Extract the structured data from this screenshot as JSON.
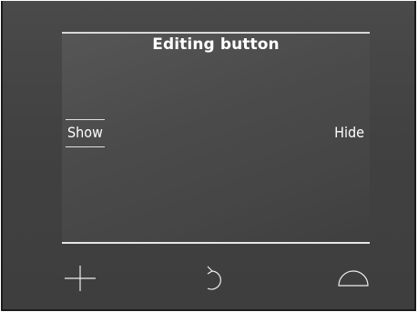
{
  "screen": {
    "title": "Editing button",
    "options": {
      "show_label": "Show",
      "hide_label": "Hide",
      "selected": "Show"
    }
  },
  "controls": {
    "left_icon": "plus-icon",
    "center_icon": "back-arrow-icon",
    "right_icon": "dome-icon"
  },
  "colors": {
    "panel": "#444444",
    "screen": "#4b4b4b",
    "text": "#ffffff",
    "lines": "#e0e0e0"
  }
}
